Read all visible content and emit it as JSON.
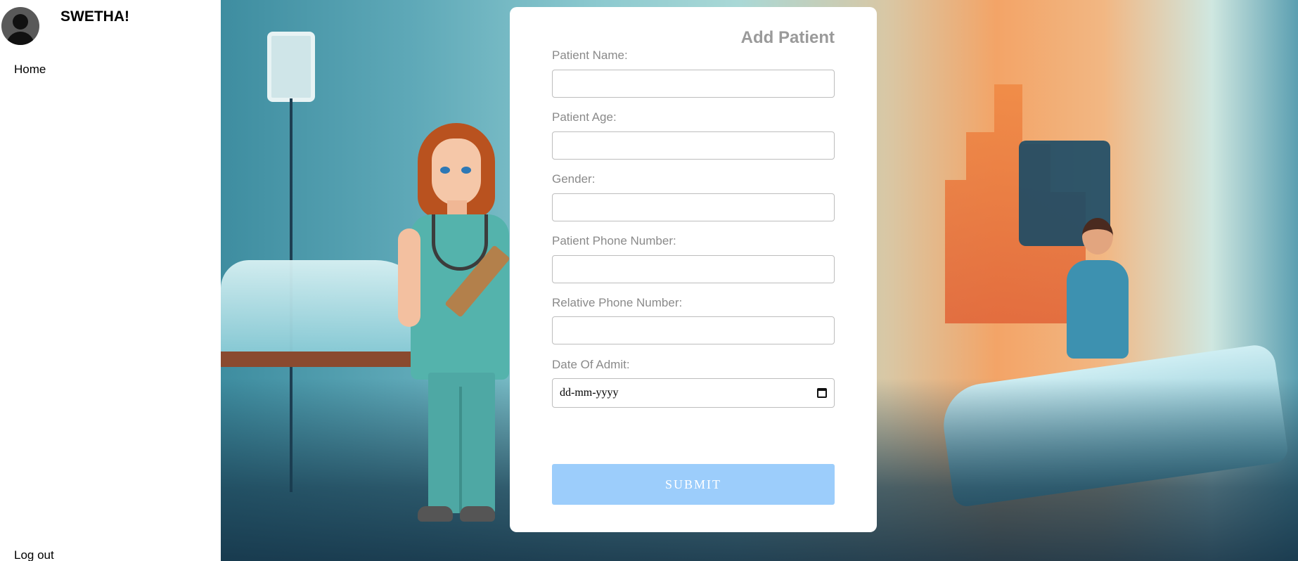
{
  "sidebar": {
    "username": "SWETHA!",
    "avatar_icon": "user-avatar-icon",
    "nav": {
      "home": "Home",
      "logout": "Log out"
    }
  },
  "form": {
    "title": "Add Patient",
    "fields": [
      {
        "label": "Patient Name:",
        "value": ""
      },
      {
        "label": "Patient Age:",
        "value": ""
      },
      {
        "label": "Gender:",
        "value": ""
      },
      {
        "label": "Patient Phone Number:",
        "value": ""
      },
      {
        "label": "Relative Phone Number:",
        "value": ""
      },
      {
        "label": "Date Of Admit:",
        "placeholder": "dd-mm-yyyy"
      }
    ],
    "submit_label": "SUBMIT",
    "colors": {
      "submit_bg": "#9ccdfb",
      "label": "#8a8a8a",
      "title": "#9a9a9a"
    }
  }
}
